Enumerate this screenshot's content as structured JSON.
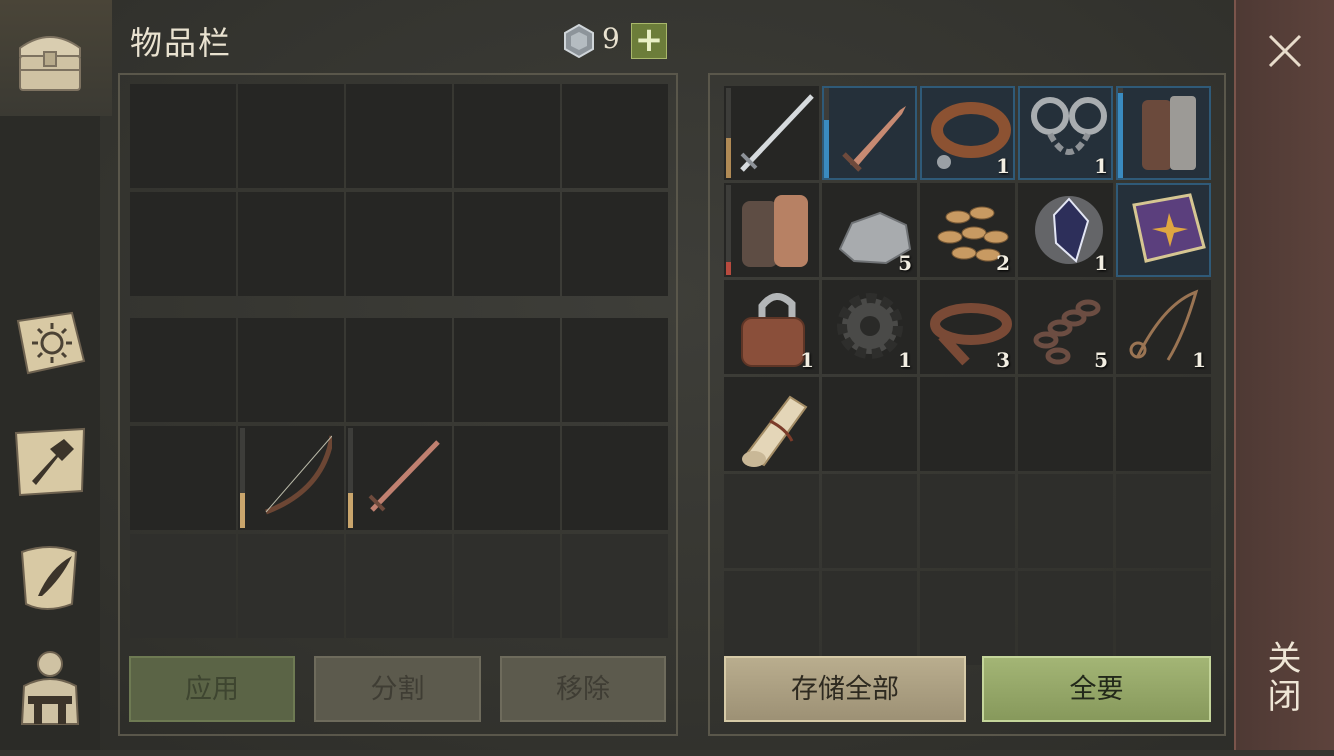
{
  "header": {
    "title": "物品栏",
    "currency_count": "9",
    "plus_label": "+"
  },
  "left_panel": {
    "slots": [
      {
        "item": null
      },
      {
        "item": null
      },
      {
        "item": null
      },
      {
        "item": null
      },
      {
        "item": null
      },
      {
        "item": null
      },
      {
        "item": null
      },
      {
        "item": null
      },
      {
        "item": null
      },
      {
        "item": null
      }
    ],
    "equip_slots": [
      {
        "item": null
      },
      {
        "item": null
      },
      {
        "item": null
      },
      {
        "item": null
      },
      {
        "item": null
      },
      {
        "item": null
      },
      {
        "item": "bow-icon",
        "durability": 0.35
      },
      {
        "item": "short-sword-icon",
        "durability": 0.35
      },
      {
        "item": null
      },
      {
        "item": null
      },
      {
        "item": null
      },
      {
        "item": null
      },
      {
        "item": null
      },
      {
        "item": null
      },
      {
        "item": null
      }
    ]
  },
  "right_panel": {
    "items": [
      {
        "icon": "long-sword-icon",
        "count": "",
        "durability": 0.45,
        "dur_color": "#b08a55",
        "highlight": false
      },
      {
        "icon": "bronze-dagger-icon",
        "count": "",
        "durability": 0.65,
        "dur_color": "#3a8bc0",
        "highlight": true
      },
      {
        "icon": "leather-collar-icon",
        "count": "1",
        "highlight": true
      },
      {
        "icon": "iron-shackles-icon",
        "count": "1",
        "highlight": true
      },
      {
        "icon": "leather-armor-icon",
        "count": "",
        "durability": 0.95,
        "dur_color": "#3a8bc0",
        "highlight": true
      },
      {
        "icon": "chainmail-gloves-icon",
        "count": "",
        "durability": 0.15,
        "dur_color": "#b84a3e",
        "highlight": false
      },
      {
        "icon": "stone-icon",
        "count": "5",
        "highlight": false
      },
      {
        "icon": "seeds-icon",
        "count": "2",
        "highlight": false
      },
      {
        "icon": "crystal-icon",
        "count": "1",
        "highlight": false
      },
      {
        "icon": "purple-book-icon",
        "count": "",
        "highlight": true
      },
      {
        "icon": "padlock-icon",
        "count": "1",
        "highlight": false
      },
      {
        "icon": "gear-icon",
        "count": "1",
        "highlight": false
      },
      {
        "icon": "leather-strap-icon",
        "count": "3",
        "highlight": false
      },
      {
        "icon": "chain-icon",
        "count": "5",
        "highlight": false
      },
      {
        "icon": "rope-icon",
        "count": "1",
        "highlight": false
      },
      {
        "icon": "scroll-icon",
        "count": "",
        "highlight": false
      }
    ]
  },
  "buttons": {
    "apply": "应用",
    "split": "分割",
    "remove": "移除",
    "store_all": "存储全部",
    "take_all": "全要"
  },
  "close_label": "关闭",
  "sidebar": [
    "chest-icon",
    "sun-book-icon",
    "hammer-map-icon",
    "quill-scroll-icon",
    "character-backpack-icon"
  ]
}
